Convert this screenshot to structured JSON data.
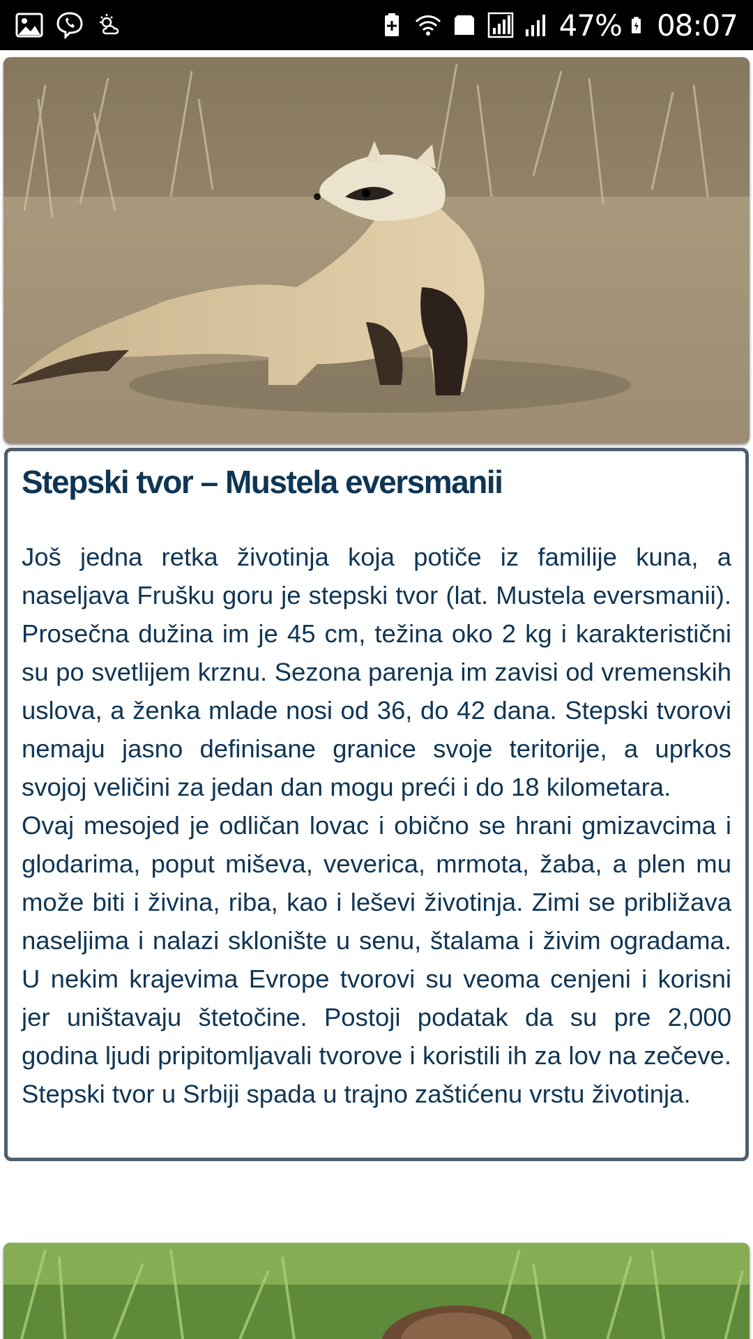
{
  "status_bar": {
    "battery_percent": "47%",
    "time": "08:07",
    "left_icons": [
      "gallery-icon",
      "viber-icon",
      "weather-icon"
    ],
    "right_icons": [
      "battery-saver-icon",
      "wifi-icon",
      "data-saver-icon",
      "signal-icon",
      "signal-icon-2",
      "battery-icon"
    ]
  },
  "article": {
    "title": "Stepski tvor – Mustela eversmanii",
    "paragraphs": [
      "Još jedna retka životinja koja potiče iz familije kuna, a naseljava Frušku goru je stepski tvor (lat. Mustela eversmanii). Prosečna dužina im je 45 cm, težina oko 2 kg i karakteristični su po svetlijem krznu. Sezona parenja im zavisi od vremenskih uslova, a ženka mlade nosi od 36, do 42 dana. Stepski tvorovi nemaju jasno definisane granice svoje teritorije, a uprkos svojoj veličini za jedan dan mogu preći i do 18 kilometara.",
      "Ovaj mesojed je odličan lovac i obično se hrani gmizavcima i glodarima, poput miševa, veverica, mrmota, žaba, a plen mu može biti i živina, riba, kao i leševi životinja. Zimi se približava naseljima i nalazi sklonište u senu, štalama i živim ogradama. U nekim krajevima Evrope tvorovi su veoma cenjeni i korisni jer uništavaju štetočine. Postoji podatak da su pre 2,000 godina ljudi pripitomljavali tvorove i koristili ih za lov na zečeve. Stepski tvor u Srbiji spada u trajno zaštićenu vrstu životinja."
    ]
  },
  "colors": {
    "title_text": "#0f3554",
    "card_border": "#4e5f6d",
    "status_bar_bg": "#000000"
  }
}
